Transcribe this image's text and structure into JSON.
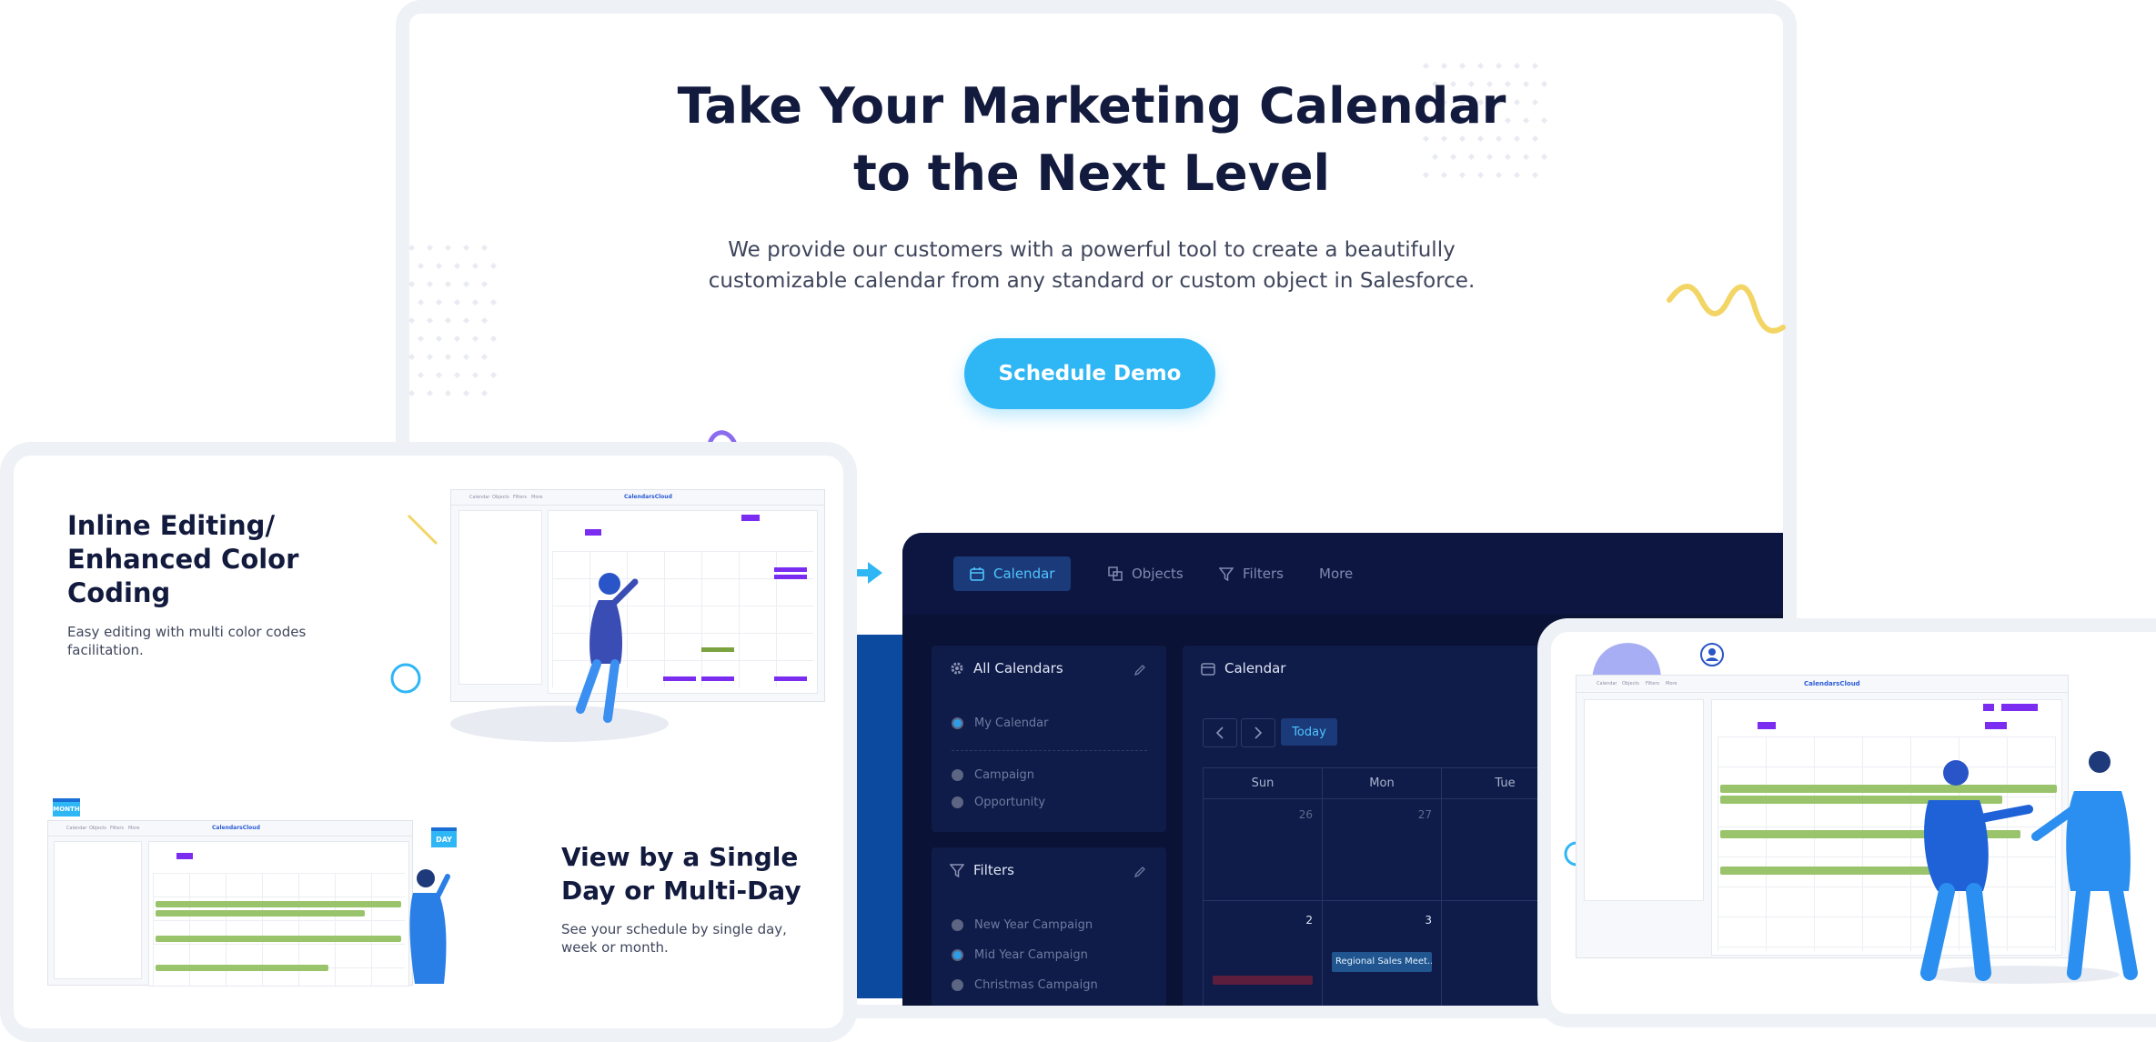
{
  "hero": {
    "title_line1": "Take Your Marketing Calendar",
    "title_line2": "to the Next Level",
    "subtitle_line1": "We provide our customers with a powerful tool to create a beautifully",
    "subtitle_line2": "customizable calendar from any standard or custom object in Salesforce.",
    "cta": "Schedule Demo"
  },
  "features": [
    {
      "title_lines": [
        "Inline Editing/",
        "Enhanced Color",
        "Coding"
      ],
      "desc_lines": [
        "Easy editing with multi color codes",
        "facilitation."
      ]
    },
    {
      "title_lines": [
        "View by a Single",
        "Day or Multi-Day"
      ],
      "desc_lines": [
        "See your schedule by single day,",
        "week or month."
      ]
    }
  ],
  "badges": {
    "month": "MONTH",
    "day": "DAY"
  },
  "app": {
    "tabs": [
      {
        "label": "Calendar",
        "icon": "calendar-icon",
        "active": true
      },
      {
        "label": "Objects",
        "icon": "objects-icon",
        "active": false
      },
      {
        "label": "Filters",
        "icon": "filter-icon",
        "active": false
      },
      {
        "label": "More",
        "icon": "",
        "active": false
      }
    ],
    "all_calendars": {
      "title": "All Calendars",
      "items": [
        "My Calendar",
        "Campaign",
        "Opportunity"
      ]
    },
    "filters": {
      "title": "Filters",
      "items": [
        "New Year Campaign",
        "Mid Year Campaign",
        "Christmas Campaign"
      ]
    },
    "calendar": {
      "title": "Calendar",
      "today": "Today",
      "weekdays": [
        "Sun",
        "Mon",
        "Tue"
      ],
      "dates_row1": [
        "26",
        "27",
        ""
      ],
      "dates_row2": [
        "2",
        "3",
        ""
      ],
      "event": "Regional Sales Meet..."
    }
  },
  "mini_tabs": [
    "Calendar",
    "Objects",
    "Filters",
    "More"
  ],
  "mini_brand": "CalendarsCloud",
  "colors": {
    "accent": "#2fb6f5",
    "navy": "#0a1335",
    "title": "#121a3d",
    "purple": "#7a2cf0",
    "green": "#9ac46c"
  }
}
